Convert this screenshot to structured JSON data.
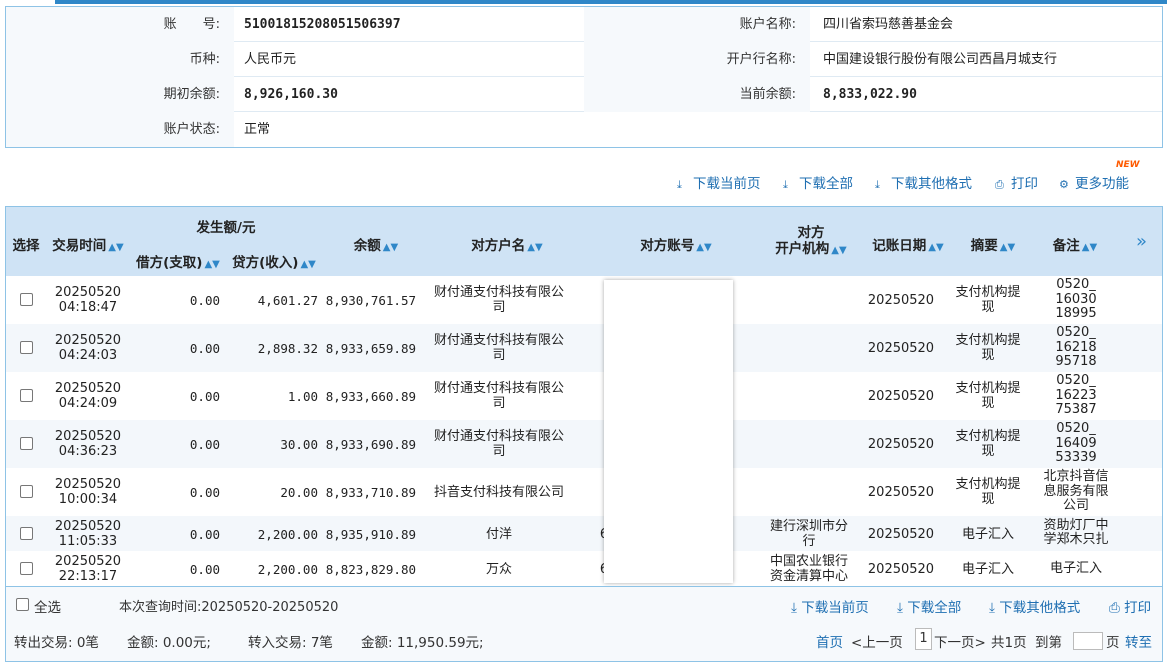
{
  "account": {
    "no_label": "账　　号:",
    "no_value": "51001815208051506397",
    "name_label": "账户名称:",
    "name_value": "四川省索玛慈善基金会",
    "currency_label": "币种:",
    "currency_value": "人民币元",
    "bank_label": "开户行名称:",
    "bank_value": "中国建设银行股份有限公司西昌月城支行",
    "opening_label": "期初余额:",
    "opening_value": "8,926,160.30",
    "current_label": "当前余额:",
    "current_value": "8,833,022.90",
    "status_label": "账户状态:",
    "status_value": "正常"
  },
  "toolbar": {
    "download_page": "下载当前页",
    "download_all": "下载全部",
    "download_other": "下载其他格式",
    "print": "打印",
    "more": "更多功能",
    "new_badge": "NEW"
  },
  "table": {
    "headers": {
      "select": "选择",
      "time": "交易时间",
      "amount_group": "发生额/元",
      "debit": "借方(支取)",
      "credit": "贷方(收入)",
      "balance": "余额",
      "cp_name": "对方户名",
      "cp_account": "对方账号",
      "cp_bank_1": "对方",
      "cp_bank_2": "开户机构",
      "post_date": "记账日期",
      "summary": "摘要",
      "remark": "备注",
      "more": "»"
    },
    "rows": [
      {
        "date": "20250520",
        "time": "04:18:47",
        "debit": "0.00",
        "credit": "4,601.27",
        "balance": "8,930,761.57",
        "cp_name_1": "财付通支付科技有限公",
        "cp_name_2": "司",
        "cp_acct": "",
        "cp_bank_1": "",
        "cp_bank_2": "",
        "post_date": "20250520",
        "summary_1": "支付机构提",
        "summary_2": "现",
        "remark_1": "0520_",
        "remark_2": "16030",
        "remark_3": "18995"
      },
      {
        "date": "20250520",
        "time": "04:24:03",
        "debit": "0.00",
        "credit": "2,898.32",
        "balance": "8,933,659.89",
        "cp_name_1": "财付通支付科技有限公",
        "cp_name_2": "司",
        "cp_acct": "",
        "cp_bank_1": "",
        "cp_bank_2": "",
        "post_date": "20250520",
        "summary_1": "支付机构提",
        "summary_2": "现",
        "remark_1": "0520_",
        "remark_2": "16218",
        "remark_3": "95718"
      },
      {
        "date": "20250520",
        "time": "04:24:09",
        "debit": "0.00",
        "credit": "1.00",
        "balance": "8,933,660.89",
        "cp_name_1": "财付通支付科技有限公",
        "cp_name_2": "司",
        "cp_acct": "",
        "cp_bank_1": "",
        "cp_bank_2": "",
        "post_date": "20250520",
        "summary_1": "支付机构提",
        "summary_2": "现",
        "remark_1": "0520_",
        "remark_2": "16223",
        "remark_3": "75387"
      },
      {
        "date": "20250520",
        "time": "04:36:23",
        "debit": "0.00",
        "credit": "30.00",
        "balance": "8,933,690.89",
        "cp_name_1": "财付通支付科技有限公",
        "cp_name_2": "司",
        "cp_acct": "",
        "cp_bank_1": "",
        "cp_bank_2": "",
        "post_date": "20250520",
        "summary_1": "支付机构提",
        "summary_2": "现",
        "remark_1": "0520_",
        "remark_2": "16409",
        "remark_3": "53339"
      },
      {
        "date": "20250520",
        "time": "10:00:34",
        "debit": "0.00",
        "credit": "20.00",
        "balance": "8,933,710.89",
        "cp_name_1": "抖音支付科技有限公司",
        "cp_name_2": "",
        "cp_acct": "",
        "cp_bank_1": "",
        "cp_bank_2": "",
        "post_date": "20250520",
        "summary_1": "支付机构提",
        "summary_2": "现",
        "remark_1": "北京抖音信",
        "remark_2": "息服务有限",
        "remark_3": "公司"
      },
      {
        "date": "20250520",
        "time": "11:05:33",
        "debit": "0.00",
        "credit": "2,200.00",
        "balance": "8,935,910.89",
        "cp_name_1": "付洋",
        "cp_name_2": "",
        "cp_acct": "6",
        "cp_bank_1": "建行深圳市分",
        "cp_bank_2": "行",
        "post_date": "20250520",
        "summary_1": "电子汇入",
        "summary_2": "",
        "remark_1": "资助灯厂中",
        "remark_2": "学郑木只扎",
        "remark_3": ""
      },
      {
        "date": "20250520",
        "time": "22:13:17",
        "debit": "0.00",
        "credit": "2,200.00",
        "balance": "8,823,829.80",
        "cp_name_1": "万众",
        "cp_name_2": "",
        "cp_acct": "6",
        "cp_bank_1": "中国农业银行",
        "cp_bank_2": "资金清算中心",
        "post_date": "20250520",
        "summary_1": "电子汇入",
        "summary_2": "",
        "remark_1": "电子汇入",
        "remark_2": "",
        "remark_3": ""
      }
    ]
  },
  "footer": {
    "select_all": "全选",
    "query_time": "本次查询时间:20250520-20250520",
    "download_page": "下载当前页",
    "download_all": "下载全部",
    "download_other": "下载其他格式",
    "print": "打印",
    "out_txn": "转出交易: 0笔",
    "out_amount": "金额: 0.00元;",
    "in_txn": "转入交易: 7笔",
    "in_amount": "金额: 11,950.59元;",
    "first": "首页",
    "prev": "<上一页",
    "page": "1",
    "next": "下一页>",
    "total": "共1页",
    "goto_label": "到第",
    "page_unit": "页",
    "goto_btn": "转至"
  }
}
